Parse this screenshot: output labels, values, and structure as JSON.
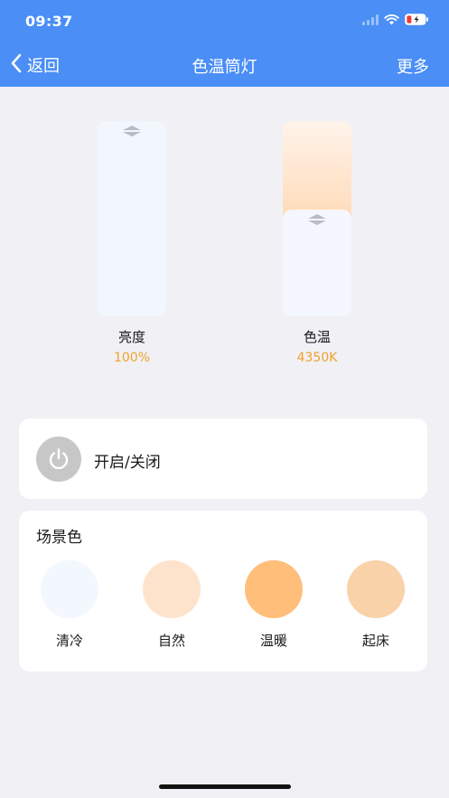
{
  "status": {
    "time": "09:37"
  },
  "nav": {
    "back_label": "返回",
    "title": "色温筒灯",
    "more_label": "更多"
  },
  "sliders": [
    {
      "label": "亮度",
      "value": "100%",
      "level": 1.0
    },
    {
      "label": "色温",
      "value": "4350K",
      "level": 0.55
    }
  ],
  "power": {
    "label": "开启/关闭",
    "state": "off"
  },
  "scene": {
    "title": "场景色",
    "items": [
      {
        "label": "清冷",
        "color": "#f3f7fe"
      },
      {
        "label": "自然",
        "color": "#fee3cc"
      },
      {
        "label": "温暖",
        "color": "#ffbe7a"
      },
      {
        "label": "起床",
        "color": "#f9d2a9"
      }
    ]
  },
  "colors": {
    "nav_bar": "#4a8ef6",
    "accent_value": "#f0a02a",
    "power_off": "#c7c7c7"
  }
}
